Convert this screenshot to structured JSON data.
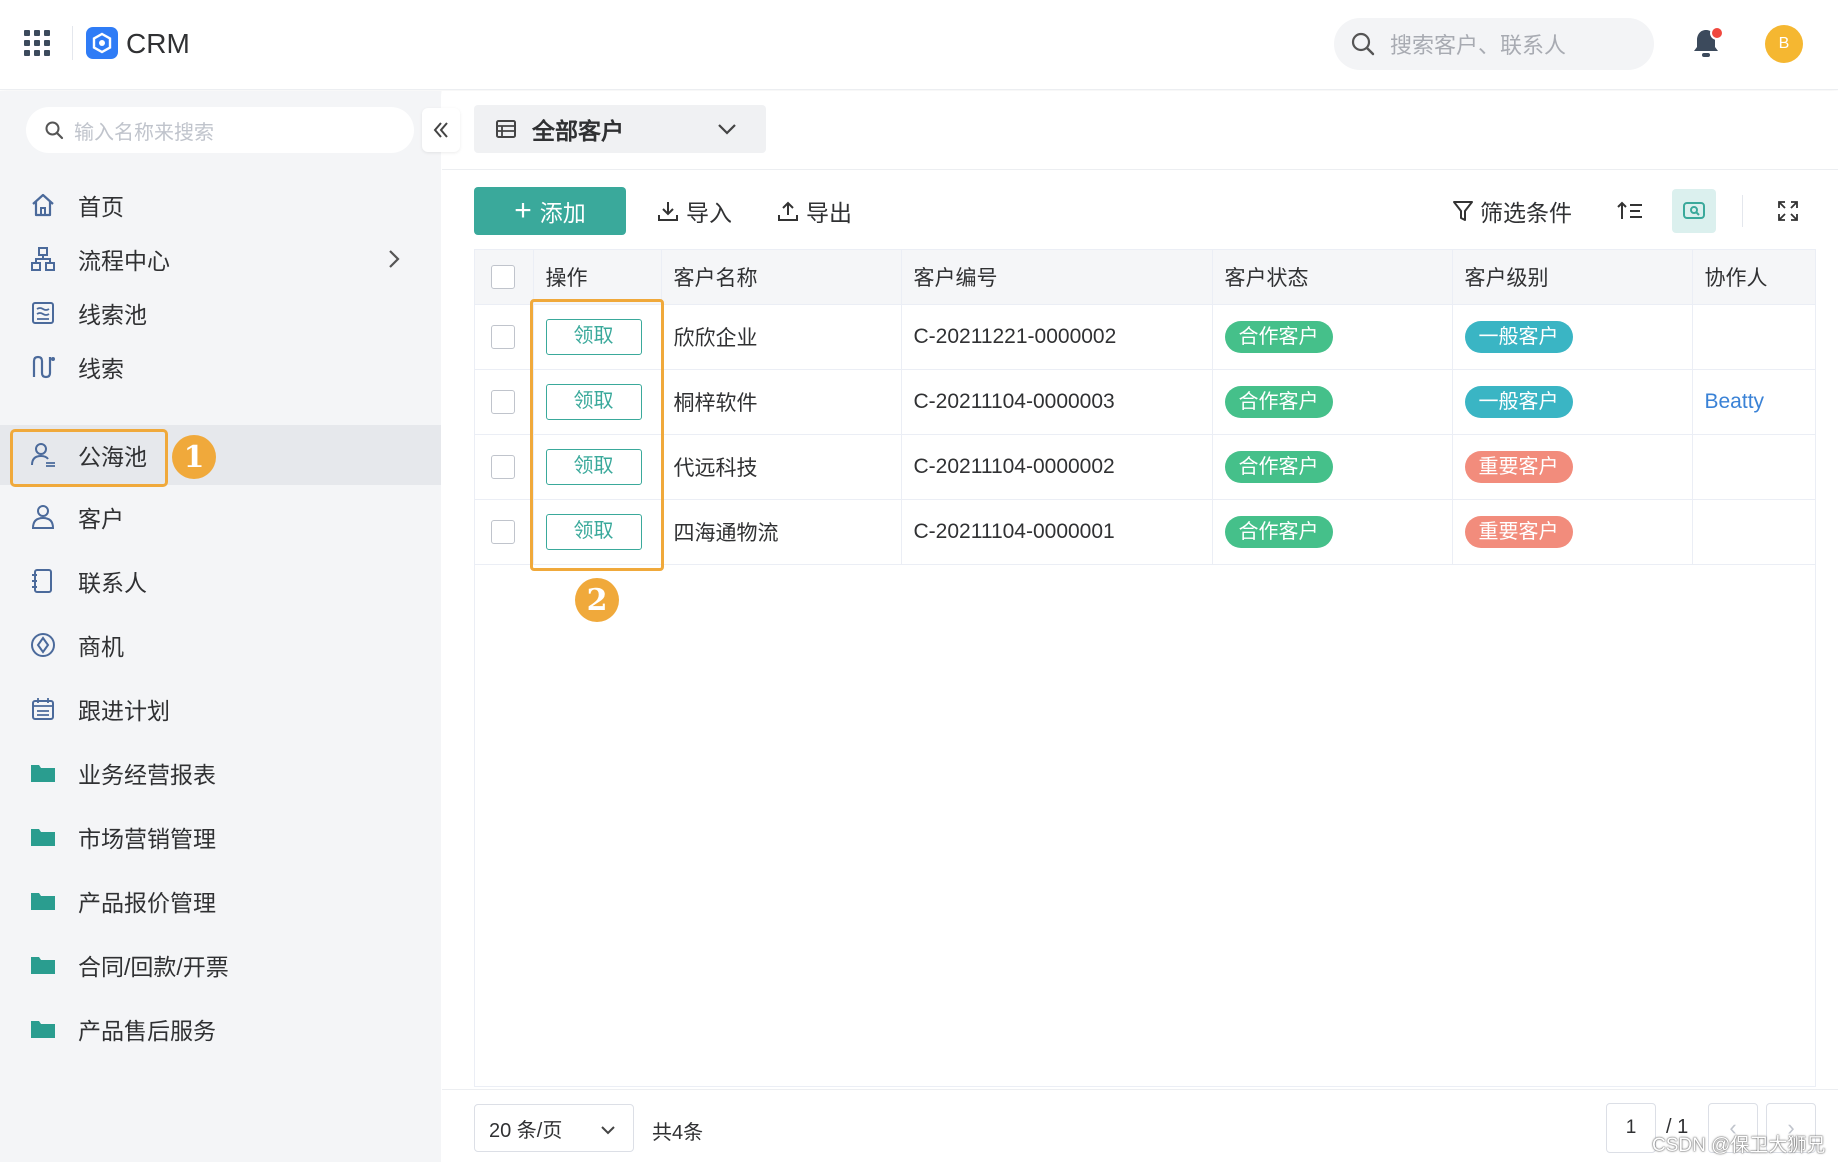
{
  "app": {
    "title": "CRM"
  },
  "header": {
    "search_placeholder": "搜索客户、联系人",
    "avatar_letter": "B"
  },
  "sidebar": {
    "search_placeholder": "输入名称来搜索",
    "items": [
      {
        "label": "首页",
        "icon": "home-icon"
      },
      {
        "label": "流程中心",
        "icon": "flow-icon"
      },
      {
        "label": "线索池",
        "icon": "lead-pool-icon"
      },
      {
        "label": "线索",
        "icon": "lead-icon"
      },
      {
        "label": "公海池",
        "icon": "public-pool-icon"
      },
      {
        "label": "客户",
        "icon": "customer-icon"
      },
      {
        "label": "联系人",
        "icon": "contact-icon"
      },
      {
        "label": "商机",
        "icon": "opportunity-icon"
      },
      {
        "label": "跟进计划",
        "icon": "calendar-icon"
      },
      {
        "label": "业务经营报表",
        "icon": "folder-icon"
      },
      {
        "label": "市场营销管理",
        "icon": "folder-icon"
      },
      {
        "label": "产品报价管理",
        "icon": "folder-icon"
      },
      {
        "label": "合同/回款/开票",
        "icon": "folder-icon"
      },
      {
        "label": "产品售后服务",
        "icon": "folder-icon"
      }
    ],
    "active": "公海池"
  },
  "annotations": {
    "step1": "1",
    "step2": "2"
  },
  "view": {
    "current": "全部客户"
  },
  "toolbar": {
    "add": "添加",
    "import": "导入",
    "export": "导出",
    "filter": "筛选条件"
  },
  "table": {
    "headers": [
      "操作",
      "客户名称",
      "客户编号",
      "客户状态",
      "客户级别",
      "协作人"
    ],
    "rows": [
      {
        "action": "领取",
        "name": "欣欣企业",
        "code": "C-20211221-0000002",
        "status": "合作客户",
        "level": "一般客户",
        "collaborator": ""
      },
      {
        "action": "领取",
        "name": "桐梓软件",
        "code": "C-20211104-0000003",
        "status": "合作客户",
        "level": "一般客户",
        "collaborator": "Beatty"
      },
      {
        "action": "领取",
        "name": "代远科技",
        "code": "C-20211104-0000002",
        "status": "合作客户",
        "level": "重要客户",
        "collaborator": ""
      },
      {
        "action": "领取",
        "name": "四海通物流",
        "code": "C-20211104-0000001",
        "status": "合作客户",
        "level": "重要客户",
        "collaborator": ""
      }
    ]
  },
  "colors": {
    "accent": "#3aa99b",
    "status_green": "#45c08a",
    "level_normal": "#3ab5c4",
    "level_important": "#f28c7c",
    "highlight": "#f0a93b"
  },
  "pagination": {
    "page_size": "20 条/页",
    "total": "共4条",
    "current_page": "1",
    "of_pages": "/ 1"
  },
  "watermark": "CSDN @保卫大狮兄"
}
